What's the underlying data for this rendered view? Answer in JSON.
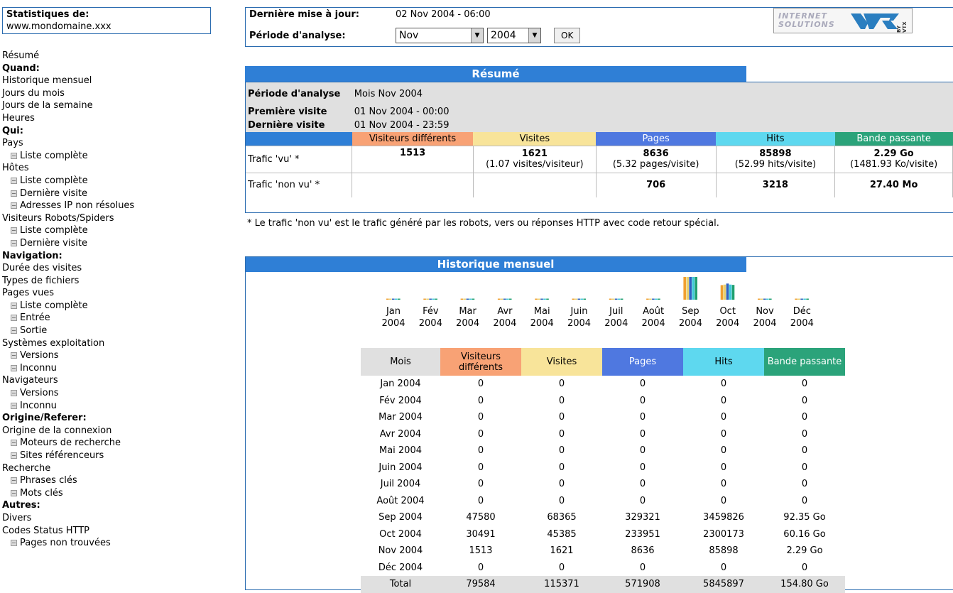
{
  "sidebar": {
    "stats_title": "Statistiques de:",
    "domain": "www.mondomaine.xxx",
    "menu": [
      {
        "label": "Résumé",
        "kind": "link"
      },
      {
        "label": "Quand:",
        "kind": "section"
      },
      {
        "label": "Historique mensuel",
        "kind": "link"
      },
      {
        "label": "Jours du mois",
        "kind": "link"
      },
      {
        "label": "Jours de la semaine",
        "kind": "link"
      },
      {
        "label": "Heures",
        "kind": "link"
      },
      {
        "label": "Qui:",
        "kind": "section"
      },
      {
        "label": "Pays",
        "kind": "link"
      },
      {
        "label": "Liste complète",
        "kind": "sub"
      },
      {
        "label": "Hôtes",
        "kind": "link"
      },
      {
        "label": "Liste complète",
        "kind": "sub"
      },
      {
        "label": "Dernière visite",
        "kind": "sub"
      },
      {
        "label": "Adresses IP non résolues",
        "kind": "sub"
      },
      {
        "label": "Visiteurs Robots/Spiders",
        "kind": "link"
      },
      {
        "label": "Liste complète",
        "kind": "sub"
      },
      {
        "label": "Dernière visite",
        "kind": "sub"
      },
      {
        "label": "Navigation:",
        "kind": "section"
      },
      {
        "label": "Durée des visites",
        "kind": "link"
      },
      {
        "label": "Types de fichiers",
        "kind": "link"
      },
      {
        "label": "Pages vues",
        "kind": "link"
      },
      {
        "label": "Liste complète",
        "kind": "sub"
      },
      {
        "label": "Entrée",
        "kind": "sub"
      },
      {
        "label": "Sortie",
        "kind": "sub"
      },
      {
        "label": "Systèmes exploitation",
        "kind": "link"
      },
      {
        "label": "Versions",
        "kind": "sub"
      },
      {
        "label": "Inconnu",
        "kind": "sub"
      },
      {
        "label": "Navigateurs",
        "kind": "link"
      },
      {
        "label": "Versions",
        "kind": "sub"
      },
      {
        "label": "Inconnu",
        "kind": "sub"
      },
      {
        "label": "Origine/Referer:",
        "kind": "section"
      },
      {
        "label": "Origine de la connexion",
        "kind": "link"
      },
      {
        "label": "Moteurs de recherche",
        "kind": "sub"
      },
      {
        "label": "Sites référenceurs",
        "kind": "sub"
      },
      {
        "label": "Recherche",
        "kind": "link"
      },
      {
        "label": "Phrases clés",
        "kind": "sub"
      },
      {
        "label": "Mots clés",
        "kind": "sub"
      },
      {
        "label": "Autres:",
        "kind": "section"
      },
      {
        "label": "Divers",
        "kind": "link"
      },
      {
        "label": "Codes Status HTTP",
        "kind": "link"
      },
      {
        "label": "Pages non trouvées",
        "kind": "sub"
      }
    ]
  },
  "header": {
    "update_label": "Dernière mise à jour:",
    "update_value": "02 Nov 2004 - 06:00",
    "period_label": "Période d'analyse:",
    "month_selected": "Nov",
    "year_selected": "2004",
    "ok_label": "OK",
    "logo_line1": "INTERNET",
    "logo_line2": "SOLUTIONS",
    "logo_by": "BY VTX"
  },
  "resume": {
    "title": "Résumé",
    "period_label": "Période d'analyse",
    "period_value": "Mois Nov 2004",
    "first_visit_label": "Première visite",
    "first_visit_value": "01 Nov 2004 - 00:00",
    "last_visit_label": "Dernière visite",
    "last_visit_value": "01 Nov 2004 - 23:59",
    "columns": [
      "Visiteurs différents",
      "Visites",
      "Pages",
      "Hits",
      "Bande passante"
    ],
    "seen_label": "Trafic 'vu' *",
    "seen": {
      "visitors": "1513",
      "visits": "1621",
      "visits_sub": "(1.07 visites/visiteur)",
      "pages": "8636",
      "pages_sub": "(5.32 pages/visite)",
      "hits": "85898",
      "hits_sub": "(52.99 hits/visite)",
      "bandwidth": "2.29 Go",
      "bandwidth_sub": "(1481.93 Ko/visite)"
    },
    "unseen_label": "Trafic 'non vu' *",
    "unseen": {
      "pages": "706",
      "hits": "3218",
      "bandwidth": "27.40 Mo"
    },
    "footnote": "* Le trafic 'non vu' est le trafic généré par les robots, vers ou réponses HTTP avec code retour spécial."
  },
  "history": {
    "title": "Historique mensuel",
    "colors": {
      "visitors": "#f0a030",
      "visits": "#e8d070",
      "pages": "#3060c0",
      "hits": "#40c8d8",
      "bandwidth": "#20a070"
    },
    "table_headers": [
      "Mois",
      "Visiteurs différents",
      "Visites",
      "Pages",
      "Hits",
      "Bande passante"
    ],
    "total_label": "Total",
    "totals": [
      "79584",
      "115371",
      "571908",
      "5845897",
      "154.80 Go"
    ]
  },
  "chart_data": {
    "type": "bar",
    "categories": [
      "Jan 2004",
      "Fév 2004",
      "Mar 2004",
      "Avr 2004",
      "Mai 2004",
      "Juin 2004",
      "Juil 2004",
      "Août 2004",
      "Sep 2004",
      "Oct 2004",
      "Nov 2004",
      "Déc 2004"
    ],
    "category_month": [
      "Jan",
      "Fév",
      "Mar",
      "Avr",
      "Mai",
      "Juin",
      "Juil",
      "Août",
      "Sep",
      "Oct",
      "Nov",
      "Déc"
    ],
    "category_year": [
      "2004",
      "2004",
      "2004",
      "2004",
      "2004",
      "2004",
      "2004",
      "2004",
      "2004",
      "2004",
      "2004",
      "2004"
    ],
    "series": [
      {
        "name": "Visiteurs différents",
        "values": [
          0,
          0,
          0,
          0,
          0,
          0,
          0,
          0,
          47580,
          30491,
          1513,
          0
        ]
      },
      {
        "name": "Visites",
        "values": [
          0,
          0,
          0,
          0,
          0,
          0,
          0,
          0,
          68365,
          45385,
          1621,
          0
        ]
      },
      {
        "name": "Pages",
        "values": [
          0,
          0,
          0,
          0,
          0,
          0,
          0,
          0,
          329321,
          233951,
          8636,
          0
        ]
      },
      {
        "name": "Hits",
        "values": [
          0,
          0,
          0,
          0,
          0,
          0,
          0,
          0,
          3459826,
          2300173,
          85898,
          0
        ]
      },
      {
        "name": "Bande passante",
        "values": [
          0,
          0,
          0,
          0,
          0,
          0,
          0,
          0,
          92.35,
          60.16,
          2.29,
          0
        ],
        "unit": "Go"
      }
    ],
    "bandwidth_display": [
      "0",
      "0",
      "0",
      "0",
      "0",
      "0",
      "0",
      "0",
      "92.35 Go",
      "60.16 Go",
      "2.29 Go",
      "0"
    ]
  }
}
